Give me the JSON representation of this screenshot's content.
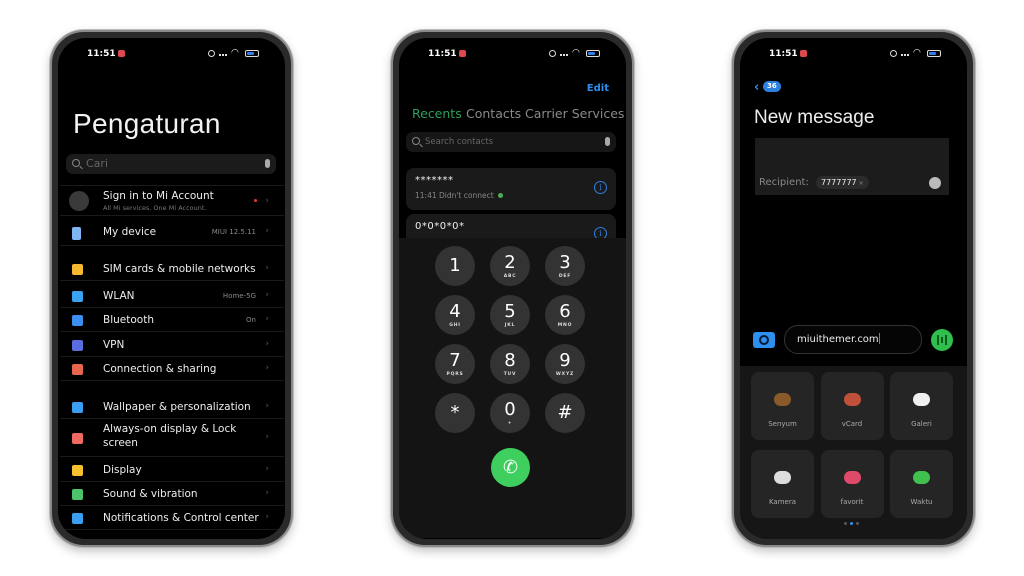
{
  "status_bar": {
    "time": "11:51"
  },
  "settings": {
    "title": "Pengaturan",
    "search_placeholder": "Cari",
    "account": {
      "label": "Sign in to Mi Account",
      "subtitle": "All Mi services. One Mi Account."
    },
    "items": [
      {
        "label": "My device",
        "value": "MIUI 12.5.11",
        "icon": "phone-icon",
        "color": "#7fb8f0"
      },
      {
        "label": "SIM cards & mobile networks",
        "value": "",
        "icon": "sim-icon",
        "color": "#f5b82e"
      },
      {
        "label": "WLAN",
        "value": "Home-5G",
        "icon": "wifi-icon",
        "color": "#3aa2f0"
      },
      {
        "label": "Bluetooth",
        "value": "On",
        "icon": "bluetooth-icon",
        "color": "#3a8ff0"
      },
      {
        "label": "VPN",
        "value": "",
        "icon": "vpn-icon",
        "color": "#5a6de0"
      },
      {
        "label": "Connection & sharing",
        "value": "",
        "icon": "connection-icon",
        "color": "#e8664e"
      },
      {
        "label": "Wallpaper & personalization",
        "value": "",
        "icon": "wallpaper-icon",
        "color": "#3a9ff0"
      },
      {
        "label": "Always-on display & Lock screen",
        "value": "",
        "icon": "lock-icon",
        "color": "#f06a64"
      },
      {
        "label": "Display",
        "value": "",
        "icon": "sun-icon",
        "color": "#f5c12e"
      },
      {
        "label": "Sound & vibration",
        "value": "",
        "icon": "speaker-icon",
        "color": "#4cc46a"
      },
      {
        "label": "Notifications & Control center",
        "value": "",
        "icon": "notification-icon",
        "color": "#3a9ff0"
      }
    ]
  },
  "dialer": {
    "edit_label": "Edit",
    "tabs": [
      {
        "label": "Recents",
        "active": true
      },
      {
        "label": "Contacts"
      },
      {
        "label": "Carrier Services"
      }
    ],
    "search_placeholder": "Search contacts",
    "recents": [
      {
        "number": "*******",
        "meta": "11:41 Didn't connect"
      },
      {
        "number": "0*0*0*0*",
        "meta": ""
      }
    ],
    "keys": [
      {
        "digit": "1",
        "letters": ""
      },
      {
        "digit": "2",
        "letters": "ABC"
      },
      {
        "digit": "3",
        "letters": "DEF"
      },
      {
        "digit": "4",
        "letters": "GHI"
      },
      {
        "digit": "5",
        "letters": "JKL"
      },
      {
        "digit": "6",
        "letters": "MNO"
      },
      {
        "digit": "7",
        "letters": "PQRS"
      },
      {
        "digit": "8",
        "letters": "TUV"
      },
      {
        "digit": "9",
        "letters": "WXYZ"
      },
      {
        "digit": "*",
        "letters": ""
      },
      {
        "digit": "0",
        "letters": "+"
      },
      {
        "digit": "#",
        "letters": ""
      }
    ],
    "call_color": "#3fcf5e"
  },
  "messages": {
    "back_badge": "36",
    "title": "New message",
    "recipient_label": "Recipient:",
    "recipient_chip": "7777777",
    "input_value": "miuithemer.com",
    "attachments": [
      {
        "label": "Senyum",
        "color": "#8a5a2a"
      },
      {
        "label": "vCard",
        "color": "#c0503a"
      },
      {
        "label": "Galeri",
        "color": "#f0f0f0"
      },
      {
        "label": "Kamera",
        "color": "#dddddd"
      },
      {
        "label": "favorit",
        "color": "#e04a6a"
      },
      {
        "label": "Waktu",
        "color": "#3fc04f"
      }
    ],
    "accent": "#2d8ff0"
  }
}
